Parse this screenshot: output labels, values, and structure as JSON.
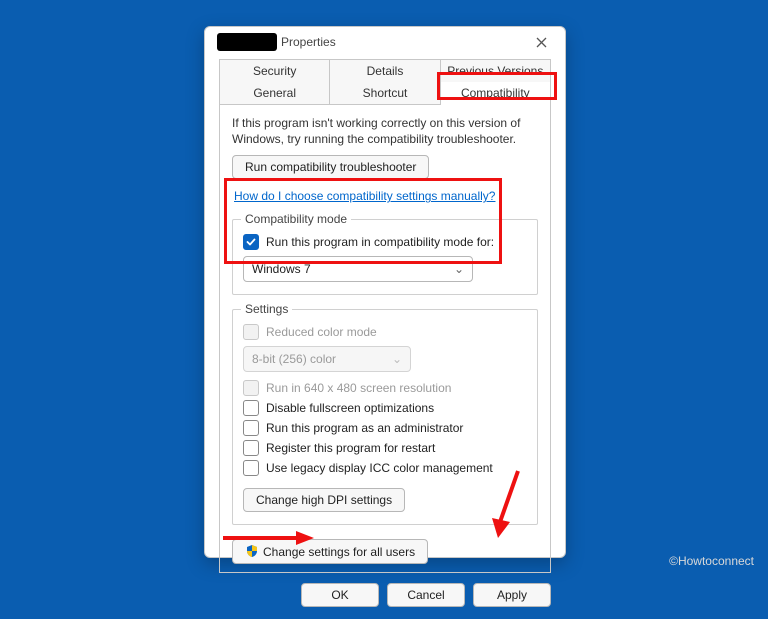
{
  "window": {
    "title": "Properties"
  },
  "tabs": {
    "row1": [
      "Security",
      "Details",
      "Previous Versions"
    ],
    "row2": [
      "General",
      "Shortcut",
      "Compatibility"
    ],
    "active": "Compatibility"
  },
  "intro": "If this program isn't working correctly on this version of Windows, try running the compatibility troubleshooter.",
  "troubleshoot_btn": "Run compatibility troubleshooter",
  "manual_link": "How do I choose compatibility settings manually?",
  "compat_group": {
    "title": "Compatibility mode",
    "checkbox": "Run this program in compatibility mode for:",
    "selected": "Windows 7"
  },
  "settings_group": {
    "title": "Settings",
    "reduced_color": "Reduced color mode",
    "color_select": "8-bit (256) color",
    "run_640": "Run in 640 x 480 screen resolution",
    "disable_fs": "Disable fullscreen optimizations",
    "run_admin": "Run this program as an administrator",
    "register_restart": "Register this program for restart",
    "legacy_icc": "Use legacy display ICC color management",
    "dpi_btn": "Change high DPI settings"
  },
  "all_users_btn": "Change settings for all users",
  "dlg": {
    "ok": "OK",
    "cancel": "Cancel",
    "apply": "Apply"
  },
  "watermark": "©Howtoconnect"
}
